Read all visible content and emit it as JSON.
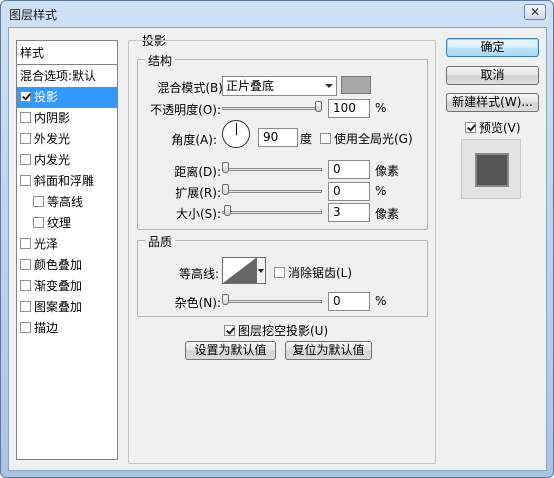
{
  "window": {
    "title": "图层样式",
    "close_glyph": "✕"
  },
  "left_panel": {
    "header": "样式",
    "items": [
      {
        "label": "混合选项:默认",
        "checkbox": false,
        "checked": false,
        "indent": false,
        "selected": false
      },
      {
        "label": "投影",
        "checkbox": true,
        "checked": true,
        "indent": false,
        "selected": true
      },
      {
        "label": "内阴影",
        "checkbox": true,
        "checked": false,
        "indent": false,
        "selected": false
      },
      {
        "label": "外发光",
        "checkbox": true,
        "checked": false,
        "indent": false,
        "selected": false
      },
      {
        "label": "内发光",
        "checkbox": true,
        "checked": false,
        "indent": false,
        "selected": false
      },
      {
        "label": "斜面和浮雕",
        "checkbox": true,
        "checked": false,
        "indent": false,
        "selected": false
      },
      {
        "label": "等高线",
        "checkbox": true,
        "checked": false,
        "indent": true,
        "selected": false
      },
      {
        "label": "纹理",
        "checkbox": true,
        "checked": false,
        "indent": true,
        "selected": false
      },
      {
        "label": "光泽",
        "checkbox": true,
        "checked": false,
        "indent": false,
        "selected": false
      },
      {
        "label": "颜色叠加",
        "checkbox": true,
        "checked": false,
        "indent": false,
        "selected": false
      },
      {
        "label": "渐变叠加",
        "checkbox": true,
        "checked": false,
        "indent": false,
        "selected": false
      },
      {
        "label": "图案叠加",
        "checkbox": true,
        "checked": false,
        "indent": false,
        "selected": false
      },
      {
        "label": "描边",
        "checkbox": true,
        "checked": false,
        "indent": false,
        "selected": false
      }
    ]
  },
  "drop_shadow": {
    "section_title": "投影",
    "structure": {
      "title": "结构",
      "blend_mode_label": "混合模式(B):",
      "blend_mode_value": "正片叠底",
      "shadow_color": "#a8a8a8",
      "opacity_label": "不透明度(O):",
      "opacity_value": "100",
      "opacity_unit": "%",
      "opacity_fraction": 1.0,
      "angle_label": "角度(A):",
      "angle_value": "90",
      "angle_unit": "度",
      "global_light_label": "使用全局光(G)",
      "global_light_checked": false,
      "distance_label": "距离(D):",
      "distance_value": "0",
      "distance_unit": "像素",
      "distance_fraction": 0,
      "spread_label": "扩展(R):",
      "spread_value": "0",
      "spread_unit": "%",
      "spread_fraction": 0,
      "size_label": "大小(S):",
      "size_value": "3",
      "size_unit": "像素",
      "size_fraction": 0.02
    },
    "quality": {
      "title": "品质",
      "contour_label": "等高线:",
      "anti_alias_label": "消除锯齿(L)",
      "anti_alias_checked": false,
      "noise_label": "杂色(N):",
      "noise_value": "0",
      "noise_unit": "%",
      "noise_fraction": 0
    },
    "knockout_label": "图层挖空投影(U)",
    "knockout_checked": true,
    "make_default_label": "设置为默认值",
    "reset_default_label": "复位为默认值"
  },
  "buttons": {
    "ok": "确定",
    "cancel": "取消",
    "new_style": "新建样式(W)...",
    "preview_label": "预览(V)",
    "preview_checked": true
  }
}
